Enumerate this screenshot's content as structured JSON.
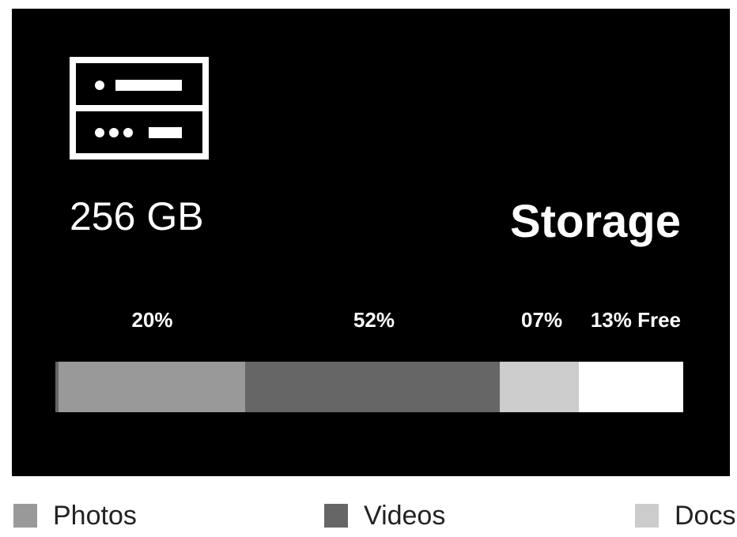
{
  "capacity": "256 GB",
  "title": "Storage",
  "icon": "server-icon",
  "segments": [
    {
      "label": "20%",
      "fraction": 0.3,
      "color": "#999999"
    },
    {
      "label": "52%",
      "fraction": 0.41,
      "color": "#666666"
    },
    {
      "label": "07%",
      "fraction": 0.127,
      "color": "#cccccc"
    },
    {
      "label": "13% Free",
      "fraction": 0.168,
      "color": "#ffffff"
    }
  ],
  "legend": [
    {
      "label": "Photos",
      "color": "#999999"
    },
    {
      "label": "Videos",
      "color": "#666666"
    },
    {
      "label": "Docs",
      "color": "#cccccc"
    }
  ]
}
